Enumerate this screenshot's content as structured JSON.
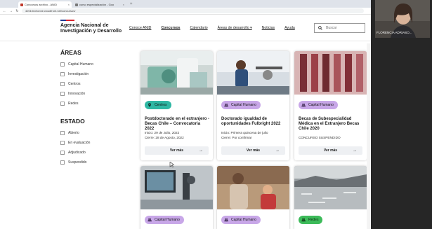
{
  "browser": {
    "tabs": [
      {
        "label": "Concursos archivo - ANID",
        "active": true
      },
      {
        "label": "curso especialización - Goo",
        "active": false
      }
    ],
    "new_tab": "+",
    "url": "4201tinxhcbxir.cloudfront.net/concursos/"
  },
  "site": {
    "logo_line1": "Agencia Nacional de",
    "logo_line2": "Investigación y Desarrollo",
    "nav": [
      {
        "label": "Conoce ANID"
      },
      {
        "label": "Concursos"
      },
      {
        "label": "Calendario"
      },
      {
        "label": "Áreas de desarrollo ▾"
      },
      {
        "label": "Noticias"
      },
      {
        "label": "Ayuda"
      }
    ],
    "search_placeholder": "Buscar"
  },
  "filters": {
    "areas_title": "ÁREAS",
    "areas": [
      {
        "label": "Capital Humano"
      },
      {
        "label": "Investigación"
      },
      {
        "label": "Centros"
      },
      {
        "label": "Innovación"
      },
      {
        "label": "Redes"
      }
    ],
    "estado_title": "ESTADO",
    "estados": [
      {
        "label": "Abierto"
      },
      {
        "label": "En evaluación"
      },
      {
        "label": "Adjudicado"
      },
      {
        "label": "Suspendido"
      }
    ]
  },
  "cards": [
    {
      "badge": "Centros",
      "badge_color": "#2eb7a3",
      "badge_icon": "location-pin-icon",
      "title": "Postdoctorado en el extranjero - Becas Chile – Convocatoria 2022",
      "meta1": "Inicio: 29 de Julio, 2022",
      "meta2": "Cierre: 28 de Agosto, 2022",
      "button": "Ver más"
    },
    {
      "badge": "Capital Humano",
      "badge_color": "#c8a7e8",
      "badge_icon": "people-icon",
      "title": "Doctorado igualdad de oportunidades Fulbright 2022",
      "meta1": "Inicio: Primera quincena de julio",
      "meta2": "Cierre: Por confirmar",
      "button": "Ver más"
    },
    {
      "badge": "Capital Humano",
      "badge_color": "#c8a7e8",
      "badge_icon": "people-icon",
      "title": "Becas de Subespecialidad Médica en el Extranjero Becas Chile 2020",
      "meta1": "CONCURSO SUSPENDIDO",
      "meta2": "",
      "button": "Ver más"
    },
    {
      "badge": "Capital Humano",
      "badge_color": "#c8a7e8",
      "badge_icon": "people-icon"
    },
    {
      "badge": "Capital Humano",
      "badge_color": "#c8a7e8",
      "badge_icon": "people-icon"
    },
    {
      "badge": "Redes",
      "badge_color": "#3dbb5a",
      "badge_icon": "people-icon"
    }
  ],
  "call": {
    "participant_name": "FLORENCIA ADRIASO..."
  }
}
